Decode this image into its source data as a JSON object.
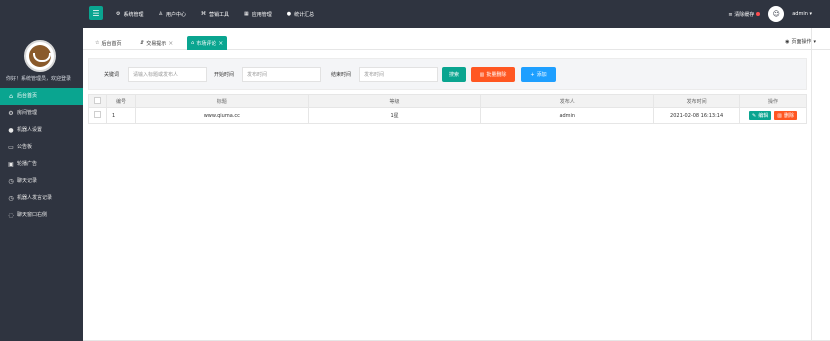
{
  "topbar": {
    "nav": [
      {
        "icon": "gear-icon",
        "label": "系统管理"
      },
      {
        "icon": "user-icon",
        "label": "用户中心"
      },
      {
        "icon": "tag-icon",
        "label": "营销工具"
      },
      {
        "icon": "grid-icon",
        "label": "应用管理"
      },
      {
        "icon": "chat-icon",
        "label": "统计汇总"
      }
    ],
    "clear_cache": "清除缓存",
    "user": "admin"
  },
  "sidebar": {
    "welcome": "你好！系统管理员，欢迎登录",
    "items": [
      {
        "icon": "home-icon",
        "label": "后台首页",
        "active": true
      },
      {
        "icon": "gear-icon",
        "label": "房间管理",
        "active": false
      },
      {
        "icon": "person-icon",
        "label": "机器人设置",
        "active": false
      },
      {
        "icon": "board-icon",
        "label": "公告板",
        "active": false
      },
      {
        "icon": "image-icon",
        "label": "轮播广告",
        "active": false
      },
      {
        "icon": "record-icon",
        "label": "聊天记录",
        "active": false
      },
      {
        "icon": "record-icon",
        "label": "机器人发言记录",
        "active": false
      },
      {
        "icon": "shield-icon",
        "label": "聊天窗口右侧",
        "active": false
      }
    ]
  },
  "tabs": {
    "items": [
      {
        "label": "后台首页"
      },
      {
        "label": "交易提示"
      },
      {
        "label": "市场评论"
      }
    ],
    "page_action": "页面操作"
  },
  "search": {
    "keyword_label": "关键词",
    "keyword_placeholder": "请输入标题或发布人",
    "start_label": "开始时间",
    "start_placeholder": "发布时间",
    "end_label": "结束时间",
    "end_placeholder": "发布时间",
    "search_btn": "搜索",
    "batch_delete_btn": "批量删除",
    "add_btn": "添加"
  },
  "table": {
    "headers": [
      "编号",
      "标题",
      "等级",
      "发布人",
      "发布时间",
      "操作"
    ],
    "rows": [
      {
        "id": "1",
        "title": "www.qiuma.cc",
        "level": "1星",
        "author": "admin",
        "time": "2021-02-08 16:13:14",
        "edit": "编辑",
        "delete": "删除"
      }
    ]
  },
  "colors": {
    "accent": "#0aa590",
    "danger": "#ff5722",
    "sidebar_bg": "#2f3440",
    "search_blue": "#1e9fff"
  }
}
